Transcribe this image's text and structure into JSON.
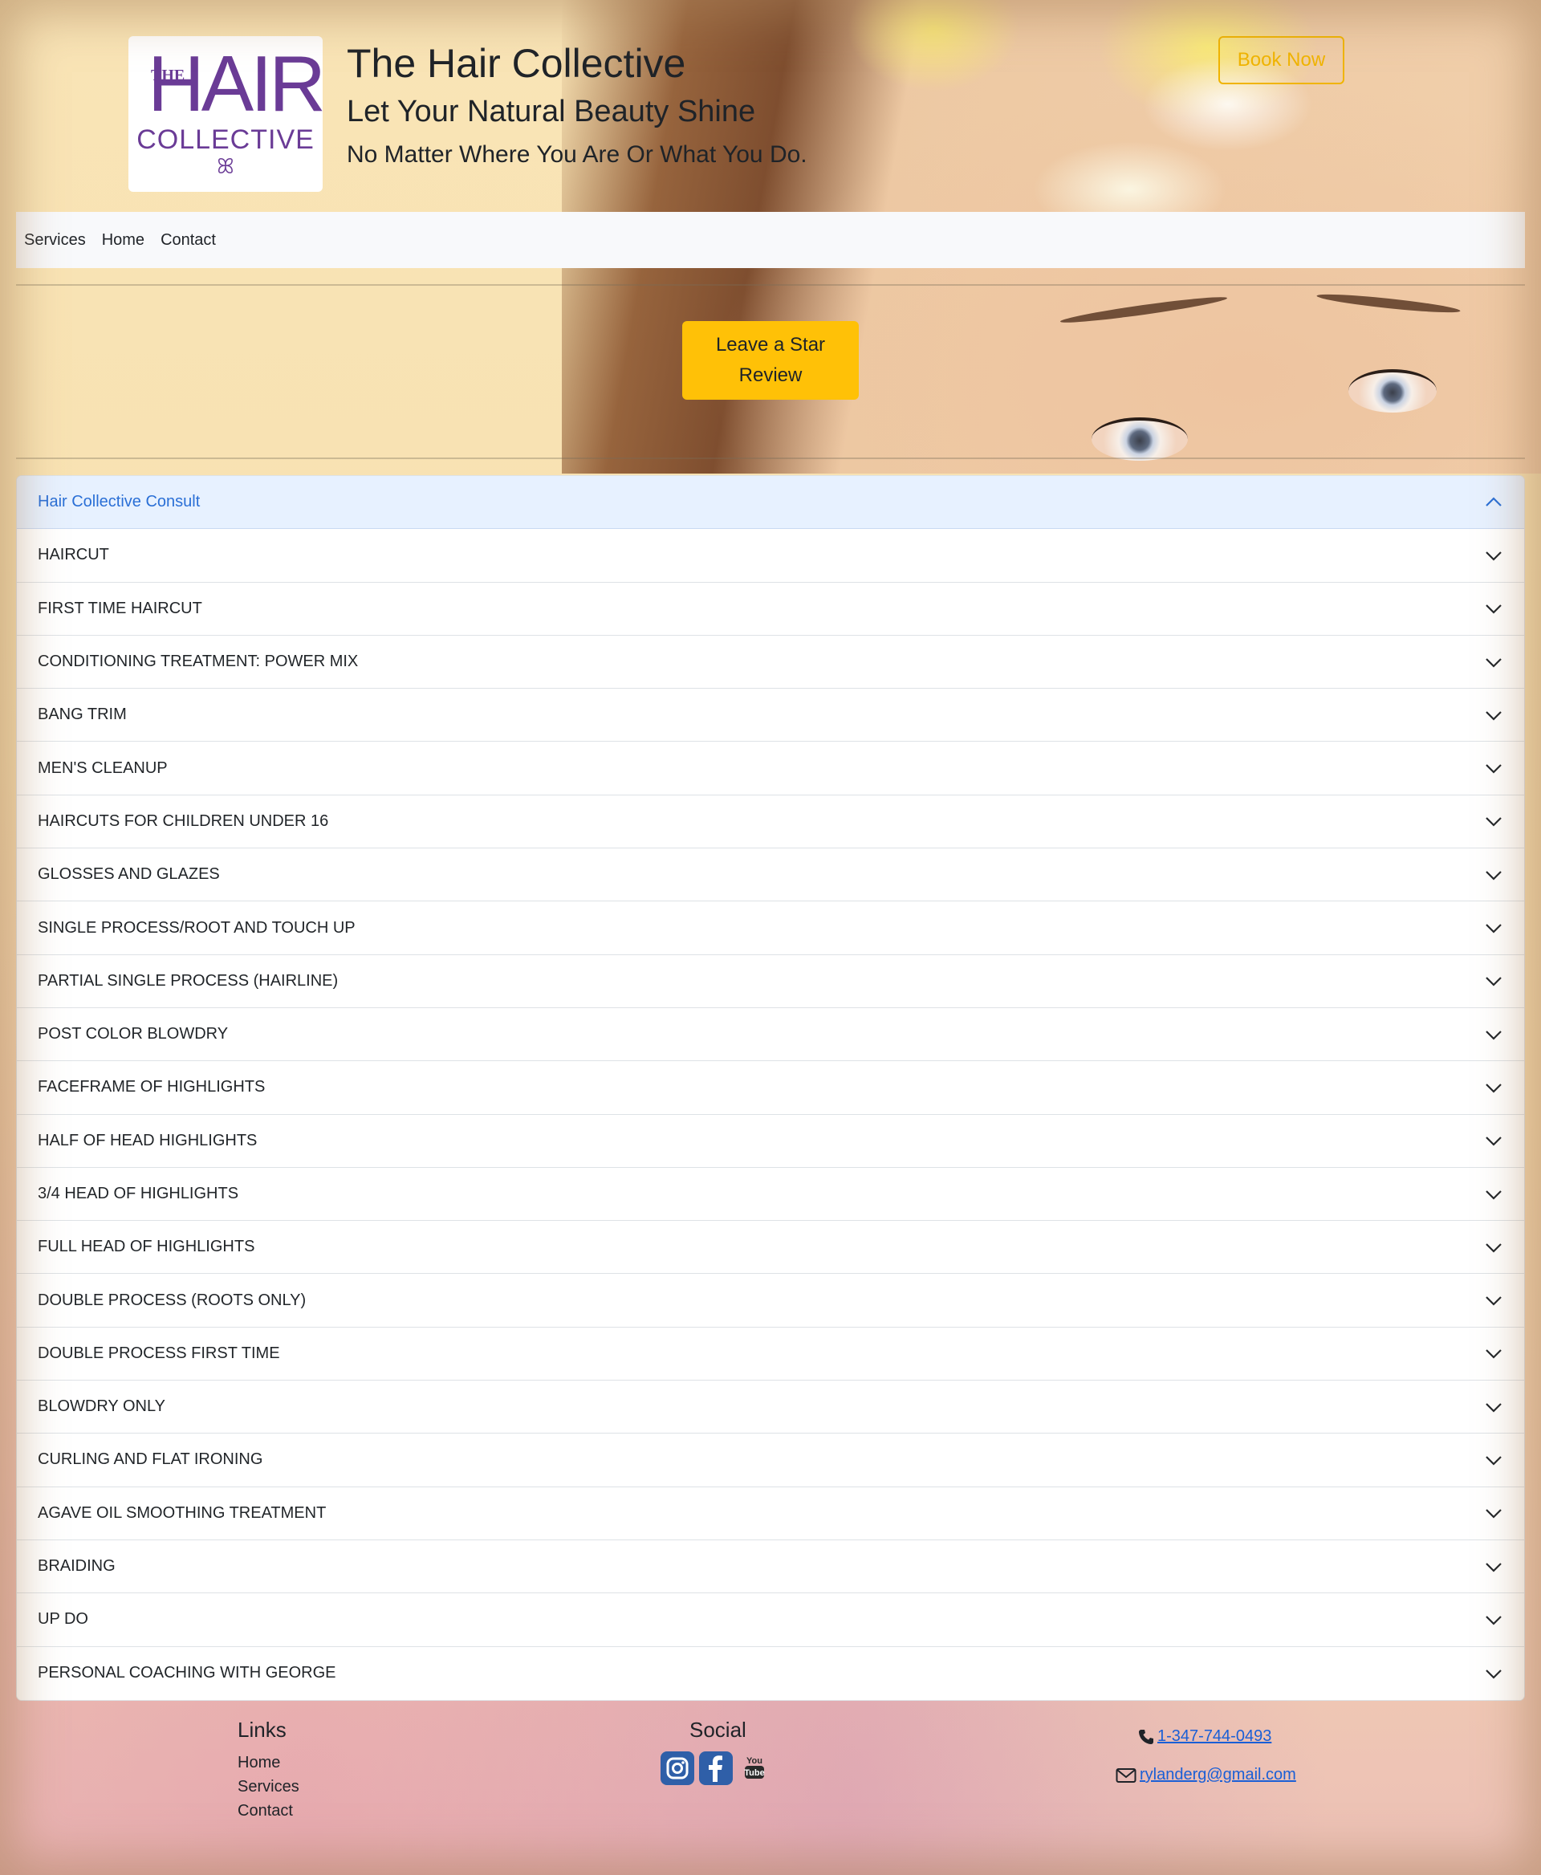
{
  "header": {
    "logo": {
      "the": "THE",
      "hair": "HAIR",
      "collective": "COLLECTIVE",
      "flourish": "ꕤ"
    },
    "title": "The Hair Collective",
    "tagline": "Let Your Natural Beauty Shine",
    "subtagline": "No Matter Where You Are Or What You Do.",
    "book_now_label": "Book Now"
  },
  "nav": {
    "items": [
      {
        "label": "Services"
      },
      {
        "label": "Home"
      },
      {
        "label": "Contact"
      }
    ]
  },
  "review_button_label": "Leave a Star Review",
  "accordion": {
    "items": [
      {
        "label": "Hair Collective Consult",
        "expanded": true
      },
      {
        "label": "HAIRCUT"
      },
      {
        "label": "FIRST TIME HAIRCUT"
      },
      {
        "label": "CONDITIONING TREATMENT: POWER MIX"
      },
      {
        "label": "BANG TRIM"
      },
      {
        "label": "MEN'S CLEANUP"
      },
      {
        "label": "HAIRCUTS FOR CHILDREN UNDER 16"
      },
      {
        "label": "GLOSSES AND GLAZES"
      },
      {
        "label": "SINGLE PROCESS/ROOT AND TOUCH UP"
      },
      {
        "label": "PARTIAL SINGLE PROCESS (HAIRLINE)"
      },
      {
        "label": "POST COLOR BLOWDRY"
      },
      {
        "label": "FACEFRAME OF HIGHLIGHTS"
      },
      {
        "label": "HALF OF HEAD HIGHLIGHTS"
      },
      {
        "label": "3/4 HEAD OF HIGHLIGHTS"
      },
      {
        "label": "FULL HEAD OF HIGHLIGHTS"
      },
      {
        "label": "DOUBLE PROCESS (ROOTS ONLY)"
      },
      {
        "label": "DOUBLE PROCESS FIRST TIME"
      },
      {
        "label": "BLOWDRY ONLY"
      },
      {
        "label": "CURLING AND FLAT IRONING"
      },
      {
        "label": "AGAVE OIL SMOOTHING TREATMENT"
      },
      {
        "label": "BRAIDING"
      },
      {
        "label": "UP DO"
      },
      {
        "label": "PERSONAL COACHING WITH GEORGE"
      }
    ]
  },
  "footer": {
    "links_heading": "Links",
    "links": [
      {
        "label": "Home"
      },
      {
        "label": "Services"
      },
      {
        "label": "Contact"
      }
    ],
    "social_heading": "Social",
    "social": [
      {
        "icon": "instagram-icon",
        "color": "#2f5fa8"
      },
      {
        "icon": "facebook-icon",
        "color": "#2f5fa8"
      },
      {
        "icon": "youtube-icon",
        "text": "You Tube"
      }
    ],
    "phone": " 1-347-744-0493",
    "email": " rylanderg@gmail.com"
  },
  "colors": {
    "accent_yellow": "#ffc107",
    "book_now": "#f0b400",
    "logo_purple": "#6a3b96",
    "link_blue": "#1a5fd6",
    "accordion_active_bg": "#e7f1ff"
  }
}
